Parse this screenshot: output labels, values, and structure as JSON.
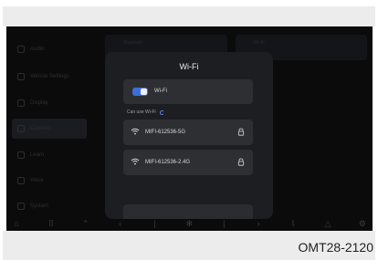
{
  "figure_code": "OMT28-2120",
  "sidebar": {
    "items": [
      {
        "label": "Audio"
      },
      {
        "label": "Vehicle Settings"
      },
      {
        "label": "Display"
      },
      {
        "label": "Connect"
      },
      {
        "label": "Learn"
      },
      {
        "label": "Voice"
      },
      {
        "label": "System"
      }
    ]
  },
  "background_cards": [
    {
      "label": "Bluetooth"
    },
    {
      "label": "Wi-Fi"
    }
  ],
  "dialog": {
    "title": "Wi-Fi",
    "toggle": {
      "label": "Wi-Fi",
      "on": true
    },
    "section_label": "Can use Wi-Fi",
    "networks": [
      {
        "name": "MIFI-612536-5G",
        "locked": true
      },
      {
        "name": "MIFI-612536-2.4G",
        "locked": true
      }
    ]
  },
  "colors": {
    "accent": "#3d6fd6",
    "dialog_bg": "#1d1e21",
    "row_bg": "#2d2f33",
    "screen_bg": "#0b0b0c"
  }
}
